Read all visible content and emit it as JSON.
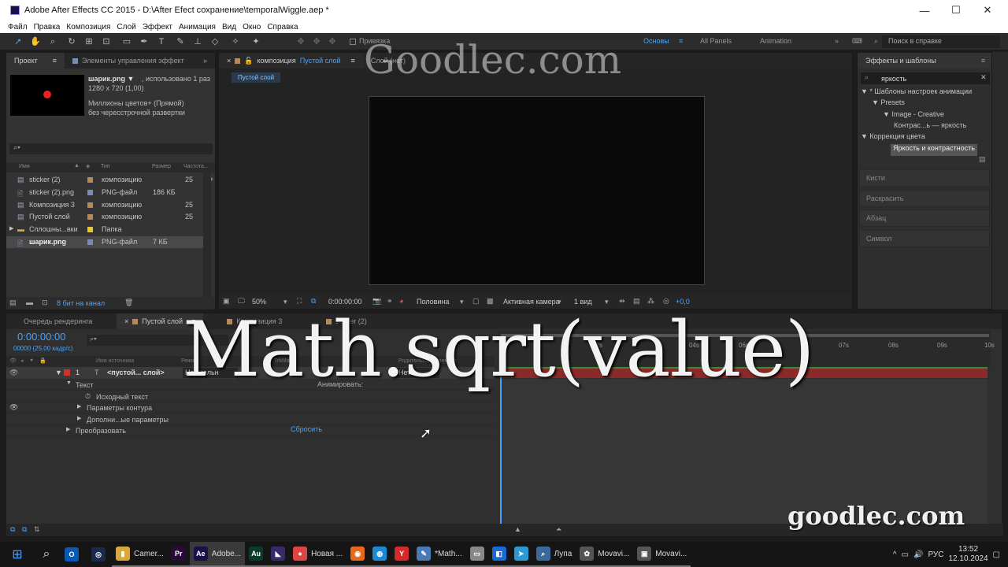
{
  "titlebar": {
    "title": "Adobe After Effects CC 2015 - D:\\After Efect сохранение\\temporalWiggle.aep *",
    "minimize": "—",
    "maximize": "☐",
    "close": "✕"
  },
  "menu": [
    "Файл",
    "Правка",
    "Композиция",
    "Слой",
    "Эффект",
    "Анимация",
    "Вид",
    "Окно",
    "Справка"
  ],
  "toolbar": {
    "snap_label": "Привязка",
    "workspaces": [
      "Основы",
      "All Panels",
      "Animation"
    ],
    "help_placeholder": "Поиск в справке"
  },
  "project": {
    "tabs": [
      "Проект",
      "Элементы управления эффект"
    ],
    "item_name": "шарик.png ▼",
    "item_used": ", использовано 1 раз",
    "item_size": "1280 x 720 (1,00)",
    "item_colors": "Миллионы цветов+ (Прямой)",
    "item_interlace": "без чересстрочной развертки",
    "columns": [
      "Имя",
      "Тип",
      "Размер",
      "Частота..."
    ],
    "rows": [
      {
        "name": "sticker (2)",
        "type": "композицию",
        "size": "",
        "rate": "25",
        "kind": "comp"
      },
      {
        "name": "sticker (2).png",
        "type": "PNG-файл",
        "size": "186 КБ",
        "rate": "",
        "kind": "png"
      },
      {
        "name": "Композиция 3",
        "type": "композицию",
        "size": "",
        "rate": "25",
        "kind": "comp"
      },
      {
        "name": "Пустой слой",
        "type": "композицию",
        "size": "",
        "rate": "25",
        "kind": "comp"
      },
      {
        "name": "Сплошны...вки",
        "type": "Папка",
        "size": "",
        "rate": "",
        "kind": "folder"
      },
      {
        "name": "шарик.png",
        "type": "PNG-файл",
        "size": "7 КБ",
        "rate": "",
        "kind": "png"
      }
    ],
    "bitdepth": "8 бит на канал"
  },
  "composition": {
    "tab_label": "композиция",
    "tab_name": "Пустой слой",
    "layer_tab": "Слой (нет)",
    "crumb": "Пустой слой",
    "zoom": "50%",
    "time": "0:00:00:00",
    "resolution": "Половина",
    "camera": "Активная камера",
    "views": "1 вид",
    "exposure": "+0,0"
  },
  "effects": {
    "title": "Эффекты и шаблоны",
    "search": "яркость",
    "tree": [
      {
        "label": "▼ * Шаблоны настроек анимации",
        "indent": 0
      },
      {
        "label": "▼ Presets",
        "indent": 1
      },
      {
        "label": "▼ Image - Creative",
        "indent": 2
      },
      {
        "label": "Контрас...ь — яркость",
        "indent": 3
      },
      {
        "label": "▼ Коррекция цвета",
        "indent": 0
      },
      {
        "label": "Яркость и контрастность",
        "indent": 1
      }
    ],
    "collapsed": [
      "Кисти",
      "Раскрасить",
      "Абзац",
      "Символ"
    ]
  },
  "timeline": {
    "tabs": [
      "Очередь рендеринга",
      "Пустой слой",
      "Композиция 3",
      "sticker (2)"
    ],
    "timecode": "0:00:00:00",
    "fps": "00000 (25.00 кадр/с)",
    "cols": [
      "Имя источника",
      "Режим",
      "T",
      "TrkMat",
      "Родительский элемент"
    ],
    "layer_num": "1",
    "layer_name": "<пустой... слой>",
    "layer_mode": "Нормальн",
    "layer_parent": "Нет",
    "props": [
      "Текст",
      "Исходный текст",
      "Параметры контура",
      "Дополни...ые параметры",
      "Преобразовать"
    ],
    "animate": "Анимировать:",
    "reset": "Сбросить",
    "ruler": [
      "02s",
      "04s",
      "06s",
      "07s",
      "08s",
      "09s",
      "10s"
    ]
  },
  "overlay": {
    "expression": "Math.sqrt(value)",
    "watermark_top": "Goodlec.com",
    "watermark_bottom": "goodlec.com"
  },
  "taskbar": {
    "items": [
      {
        "label": "Camer...",
        "icon": "▮",
        "color": "#d8a83a"
      },
      {
        "label": "",
        "icon": "Pr",
        "color": "#2a0a3a"
      },
      {
        "label": "Adobe...",
        "icon": "Ae",
        "color": "#1a1048"
      },
      {
        "label": "",
        "icon": "Au",
        "color": "#0a3a2a"
      },
      {
        "label": "",
        "icon": "◣",
        "color": "#3a2a6a"
      },
      {
        "label": "Новая ...",
        "icon": "●",
        "color": "#d44"
      },
      {
        "label": "",
        "icon": "◉",
        "color": "#e66a1a"
      },
      {
        "label": "",
        "icon": "◍",
        "color": "#1a8ad4"
      },
      {
        "label": "",
        "icon": "Y",
        "color": "#d42a2a"
      },
      {
        "label": "*Math...",
        "icon": "✎",
        "color": "#4a7ab4"
      },
      {
        "label": "",
        "icon": "▭",
        "color": "#888"
      },
      {
        "label": "",
        "icon": "◧",
        "color": "#1a6ad4"
      },
      {
        "label": "",
        "icon": "➤",
        "color": "#2a9ad4"
      },
      {
        "label": "Лупа",
        "icon": "⌕",
        "color": "#3a6a9a"
      },
      {
        "label": "Movavi...",
        "icon": "✿",
        "color": "#555"
      },
      {
        "label": "Movavi...",
        "icon": "▣",
        "color": "#555"
      }
    ],
    "lang": "РУС",
    "time": "13:52",
    "date": "12.10.2024"
  }
}
